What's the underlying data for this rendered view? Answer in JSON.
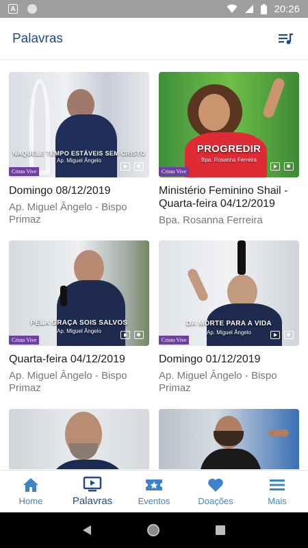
{
  "status_bar": {
    "time": "20:26"
  },
  "app_bar": {
    "title": "Palavras"
  },
  "brand_tag": "Cristo Vive",
  "cards": [
    {
      "title": "Domingo 08/12/2019",
      "subtitle": "Ap. Miguel Ângelo - Bispo Primaz",
      "caption": "NAQUELE TEMPO ESTÁVEIS SEM CRISTO",
      "caption_sub": "Ap. Miguel Ângelo"
    },
    {
      "title": "Ministério Feminino Shail - Quarta-feira 04/12/2019",
      "subtitle": "Bpa. Rosanna Ferreira",
      "caption": "PROGREDIR",
      "caption_sub": "Bpa. Rosanna Ferreira"
    },
    {
      "title": "Quarta-feira 04/12/2019",
      "subtitle": "Ap. Miguel Ângelo - Bispo Primaz",
      "caption": "PELA GRAÇA SOIS SALVOS",
      "caption_sub": "Ap. Miguel Ângelo"
    },
    {
      "title": "Domingo 01/12/2019",
      "subtitle": "Ap. Miguel Ângelo - Bispo Primaz",
      "caption": "DA MORTE PARA A VIDA",
      "caption_sub": "Ap. Miguel Ângelo"
    },
    {
      "title": "",
      "subtitle": "",
      "caption": "",
      "caption_sub": ""
    },
    {
      "title": "",
      "subtitle": "",
      "caption": "",
      "caption_sub": ""
    }
  ],
  "bottom_nav": {
    "active": "Palavras",
    "items": [
      {
        "label": "Home",
        "icon": "home-icon"
      },
      {
        "label": "Palavras",
        "icon": "tv-play-icon"
      },
      {
        "label": "Eventos",
        "icon": "ticket-star-icon"
      },
      {
        "label": "Doações",
        "icon": "heart-icon"
      },
      {
        "label": "Mais",
        "icon": "menu-icon"
      }
    ]
  },
  "colors": {
    "primary": "#1c4a8c",
    "nav_inactive": "#3d83c9",
    "status_bar": "#9e9e9e",
    "brand_tag": "#6c3fa0"
  }
}
